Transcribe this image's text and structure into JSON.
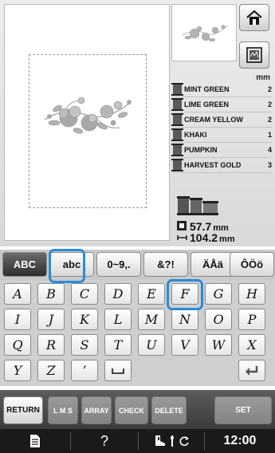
{
  "preview": {
    "unit_label": "mm"
  },
  "threads": [
    {
      "name": "MINT GREEN",
      "count": "2"
    },
    {
      "name": "LIME GREEN",
      "count": "2"
    },
    {
      "name": "CREAM YELLOW",
      "count": "2"
    },
    {
      "name": "KHAKI",
      "count": "1"
    },
    {
      "name": "PUMPKIN",
      "count": "4"
    },
    {
      "name": "HARVEST GOLD",
      "count": "3"
    }
  ],
  "size": {
    "height": "57.7",
    "width": "104.2",
    "unit": "mm"
  },
  "tabs": [
    {
      "label": "ABC",
      "selected": true
    },
    {
      "label": "abc",
      "selected": false
    },
    {
      "label": "0~9,.",
      "selected": false
    },
    {
      "label": "&?!",
      "selected": false
    },
    {
      "label": "ÄÅä",
      "selected": false
    },
    {
      "label": "ÔÖö",
      "selected": false
    }
  ],
  "keys": {
    "row1": [
      "A",
      "B",
      "C",
      "D",
      "E",
      "F",
      "G",
      "H"
    ],
    "row2": [
      "I",
      "J",
      "K",
      "L",
      "M",
      "N",
      "O",
      "P"
    ],
    "row3": [
      "Q",
      "R",
      "S",
      "T",
      "U",
      "V",
      "W",
      "X"
    ],
    "row4": [
      "Y",
      "Z",
      "’"
    ]
  },
  "buttons": {
    "return": "RETURN",
    "lms": "L M S",
    "array": "ARRAY",
    "check": "CHECK",
    "delete": "DELETE",
    "set": "SET"
  },
  "status": {
    "help": "?",
    "time": "12:00"
  },
  "colors": {
    "highlight": "#2a8bd8",
    "active_tab": "#3a3a3a"
  }
}
